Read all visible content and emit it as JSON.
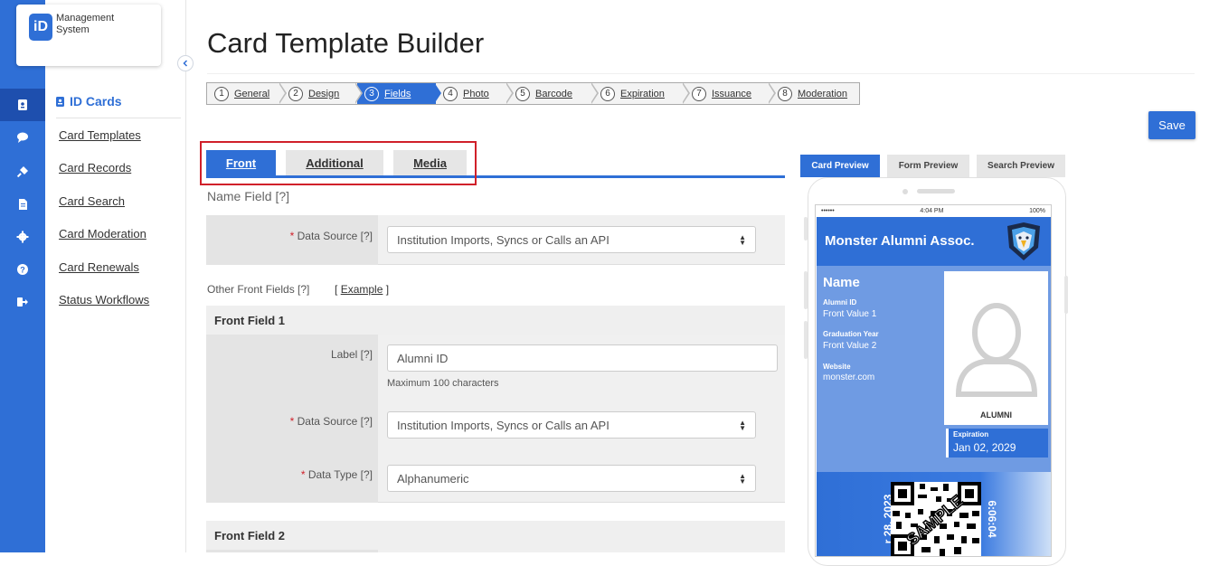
{
  "brand": {
    "badge": "iD",
    "line1": "Management",
    "line2": "System"
  },
  "rail": {
    "icons": [
      "id-card-icon",
      "chat-icon",
      "plug-icon",
      "document-icon",
      "gear-icon",
      "help-icon",
      "logout-icon"
    ]
  },
  "sidebar": {
    "heading": "ID Cards",
    "items": [
      "Card Templates",
      "Card Records",
      "Card Search",
      "Card Moderation",
      "Card Renewals",
      "Status Workflows"
    ]
  },
  "page": {
    "title": "Card Template Builder"
  },
  "steps": [
    {
      "num": "1",
      "label": "General"
    },
    {
      "num": "2",
      "label": "Design"
    },
    {
      "num": "3",
      "label": "Fields",
      "active": true
    },
    {
      "num": "4",
      "label": "Photo"
    },
    {
      "num": "5",
      "label": "Barcode"
    },
    {
      "num": "6",
      "label": "Expiration"
    },
    {
      "num": "7",
      "label": "Issuance"
    },
    {
      "num": "8",
      "label": "Moderation"
    }
  ],
  "save_label": "Save",
  "tabs": {
    "front": "Front",
    "additional": "Additional",
    "media": "Media"
  },
  "name_field": {
    "title": "Name Field [?]",
    "data_source_label": "Data Source [?]",
    "data_source_value": "Institution Imports, Syncs or Calls an API"
  },
  "other_fields": {
    "label": "Other Front Fields [?]",
    "example_open": "[",
    "example": "Example",
    "example_close": "]"
  },
  "front_field_1": {
    "title": "Front Field 1",
    "label_label": "Label [?]",
    "label_value": "Alumni ID",
    "label_hint": "Maximum 100 characters",
    "data_source_label": "Data Source [?]",
    "data_source_value": "Institution Imports, Syncs or Calls an API",
    "data_type_label": "Data Type [?]",
    "data_type_value": "Alphanumeric"
  },
  "front_field_2": {
    "title": "Front Field 2"
  },
  "preview_tabs": {
    "card": "Card Preview",
    "form": "Form Preview",
    "search": "Search Preview"
  },
  "card": {
    "status_left": "••••••",
    "status_time": "4:04 PM",
    "status_battery": "100%",
    "org": "Monster Alumni Assoc.",
    "name": "Name",
    "f1_label": "Alumni ID",
    "f1_value": "Front Value 1",
    "f2_label": "Graduation Year",
    "f2_value": "Front Value 2",
    "f3_label": "Website",
    "f3_value": "monster.com",
    "photo_caption": "ALUMNI",
    "exp_label": "Expiration",
    "exp_value": "Jan 02, 2029",
    "date_vertical": "r 28, 2023",
    "time_vertical": "6:06:04",
    "sample": "SAMPLE"
  },
  "colors": {
    "primary": "#2f6fd6",
    "rail_active": "#1e4fae",
    "highlight_box": "#d0202a"
  }
}
